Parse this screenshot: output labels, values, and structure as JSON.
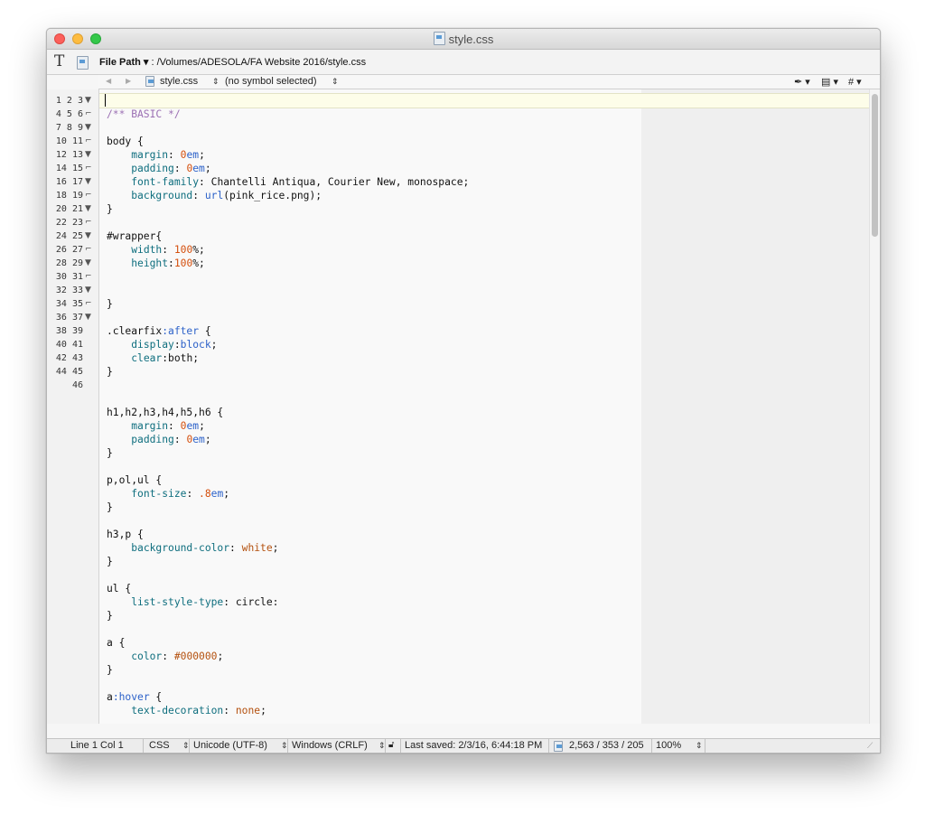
{
  "window": {
    "title": "style.css"
  },
  "pathbar": {
    "label": "File Path ▾",
    "value": " : /Volumes/ADESOLA/FA Website 2016/style.css"
  },
  "navbar": {
    "back": "◀",
    "forward": "▶",
    "file_name": "style.css",
    "symbol_value": "(no symbol selected)",
    "pen_menu": "✒ ▾",
    "doc_menu": "▤ ▾",
    "hash_menu": "# ▾"
  },
  "editor": {
    "line_numbers": "1\n2\n3\n4\n5\n6\n7\n8\n9\n10\n11\n12\n13\n14\n15\n16\n17\n18\n19\n20\n21\n22\n23\n24\n25\n26\n27\n28\n29\n30\n31\n32\n33\n34\n35\n36\n37\n38\n39\n40\n41\n42\n43\n44\n45\n46",
    "fold_markers": "\n\n\n▼\n\n\n\n\n⌐\n\n▼\n\n\n\n\n⌐\n\n▼\n\n\n⌐\n\n\n▼\n\n\n⌐\n\n▼\n\n⌐\n\n▼\n\n⌐\n\n▼\n\n⌐\n\n▼\n\n⌐\n\n▼\n"
  },
  "status": {
    "position": "Line 1 Col 1",
    "language": "CSS",
    "encoding": "Unicode (UTF-8)",
    "line_endings": "Windows (CRLF)",
    "last_saved": "Last saved: 2/3/16, 6:44:18 PM",
    "counts": "2,563 / 353 / 205",
    "zoom": "100%"
  }
}
